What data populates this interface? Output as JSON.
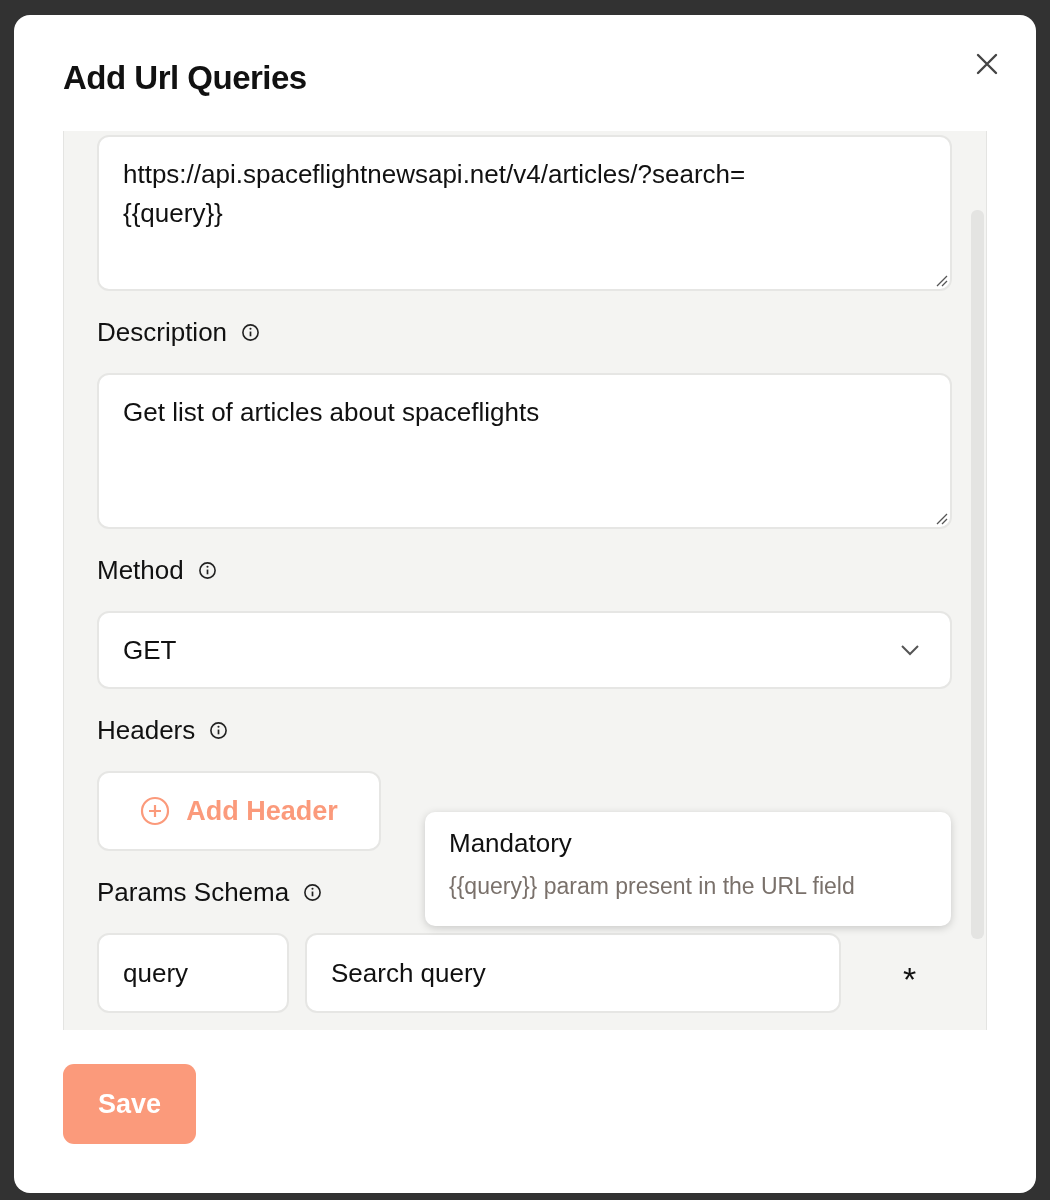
{
  "dialog": {
    "title": "Add Url Queries"
  },
  "url_field": {
    "value": "https://api.spaceflightnewsapi.net/v4/articles/?search=\n{{query}}"
  },
  "description": {
    "label": "Description",
    "value": "Get list of articles about spaceflights"
  },
  "method": {
    "label": "Method",
    "value": "GET"
  },
  "headers": {
    "label": "Headers",
    "add_button": "Add Header"
  },
  "params_schema": {
    "label": "Params Schema",
    "rows": [
      {
        "name": "query",
        "description": "Search query",
        "required_mark": "*"
      }
    ]
  },
  "tooltip": {
    "title": "Mandatory",
    "text": "{{query}} param present in the URL field"
  },
  "save_button": "Save"
}
